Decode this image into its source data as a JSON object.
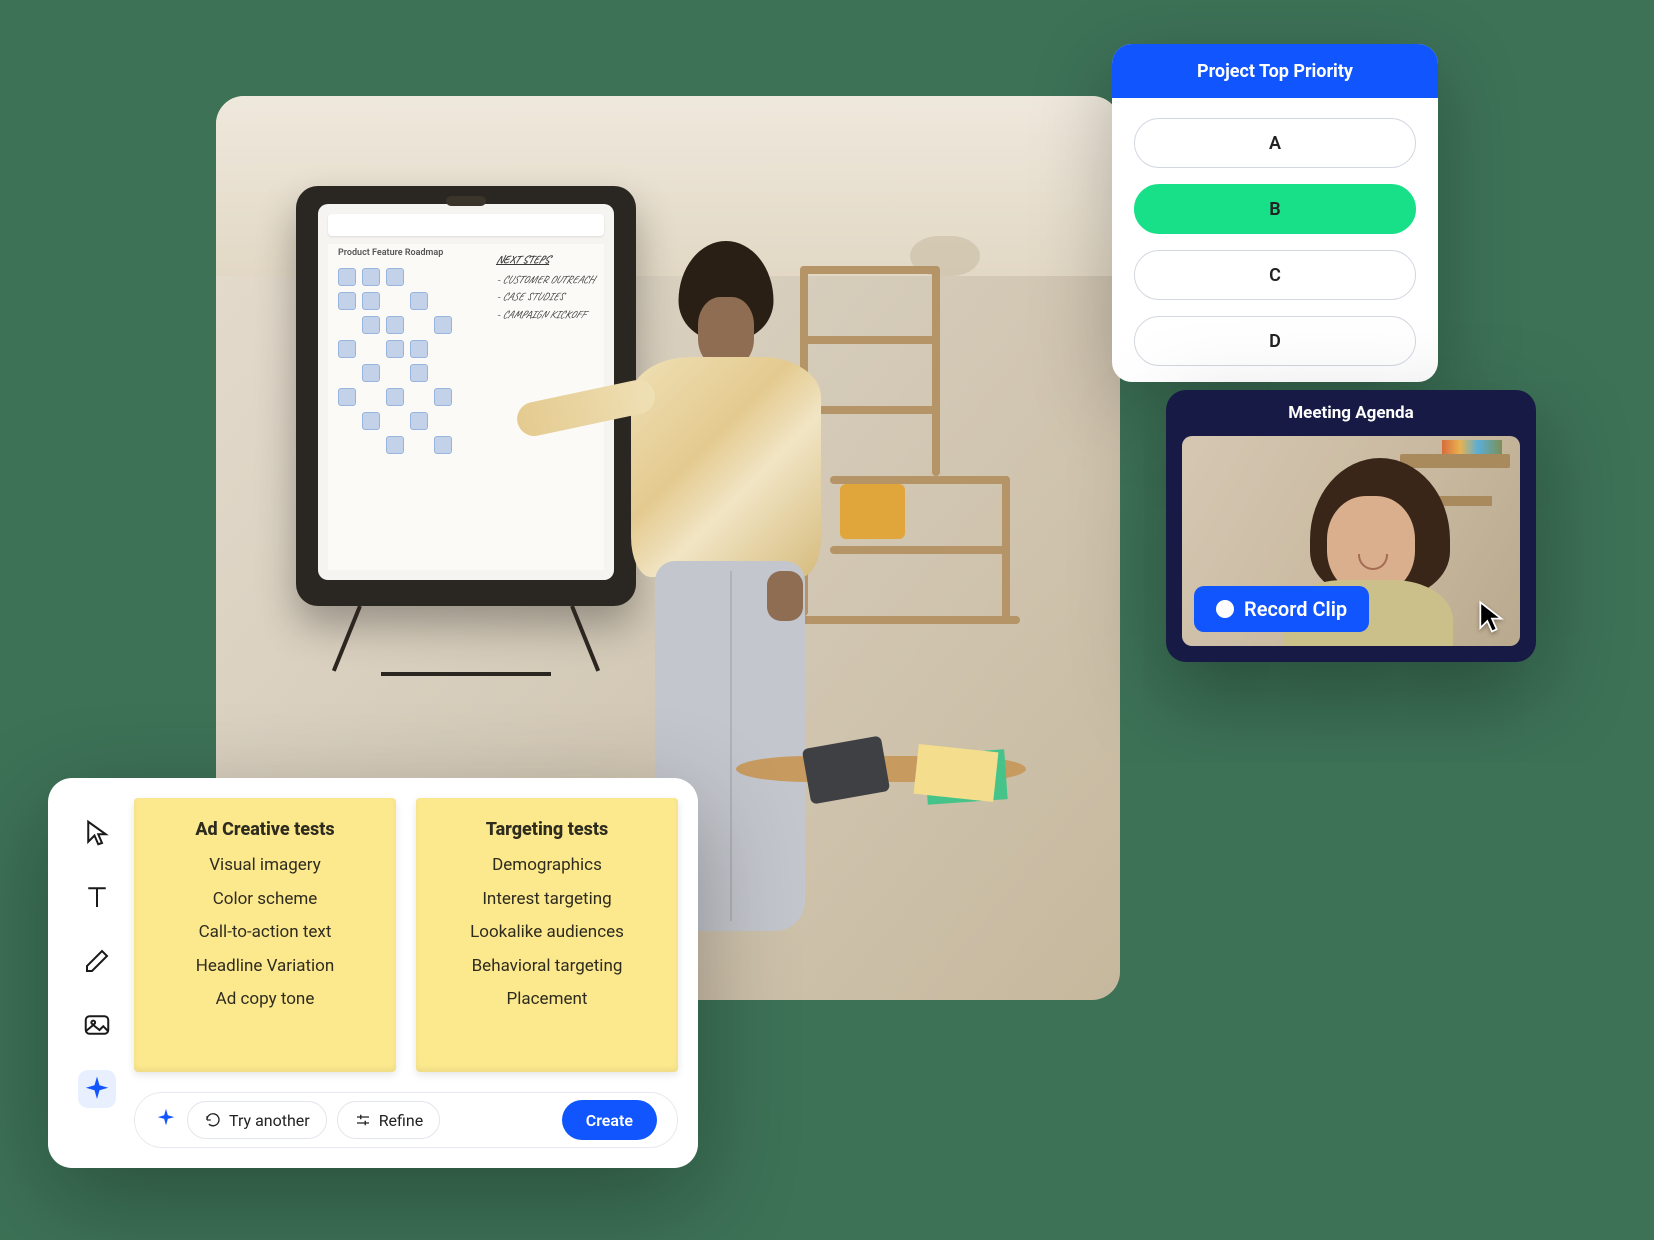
{
  "hero": {
    "board_title": "Product Feature Roadmap",
    "handwritten_heading": "NEXT STEPS",
    "handwritten_items": [
      "- CUSTOMER OUTREACH",
      "- CASE STUDIES",
      "- CAMPAIGN KICKOFF"
    ]
  },
  "poll": {
    "title": "Project Top Priority",
    "options": [
      "A",
      "B",
      "C",
      "D"
    ],
    "selected": "B"
  },
  "video": {
    "title": "Meeting Agenda",
    "button_label": "Record Clip"
  },
  "ai_panel": {
    "tools": [
      "pointer",
      "text",
      "pen",
      "image",
      "ai"
    ],
    "sticky_1": {
      "title": "Ad Creative tests",
      "items": [
        "Visual imagery",
        "Color scheme",
        "Call-to-action text",
        "Headline Variation",
        "Ad copy tone"
      ]
    },
    "sticky_2": {
      "title": "Targeting tests",
      "items": [
        "Demographics",
        "Interest targeting",
        "Lookalike audiences",
        "Behavioral targeting",
        "Placement"
      ]
    },
    "try_label": "Try another",
    "refine_label": "Refine",
    "create_label": "Create"
  }
}
